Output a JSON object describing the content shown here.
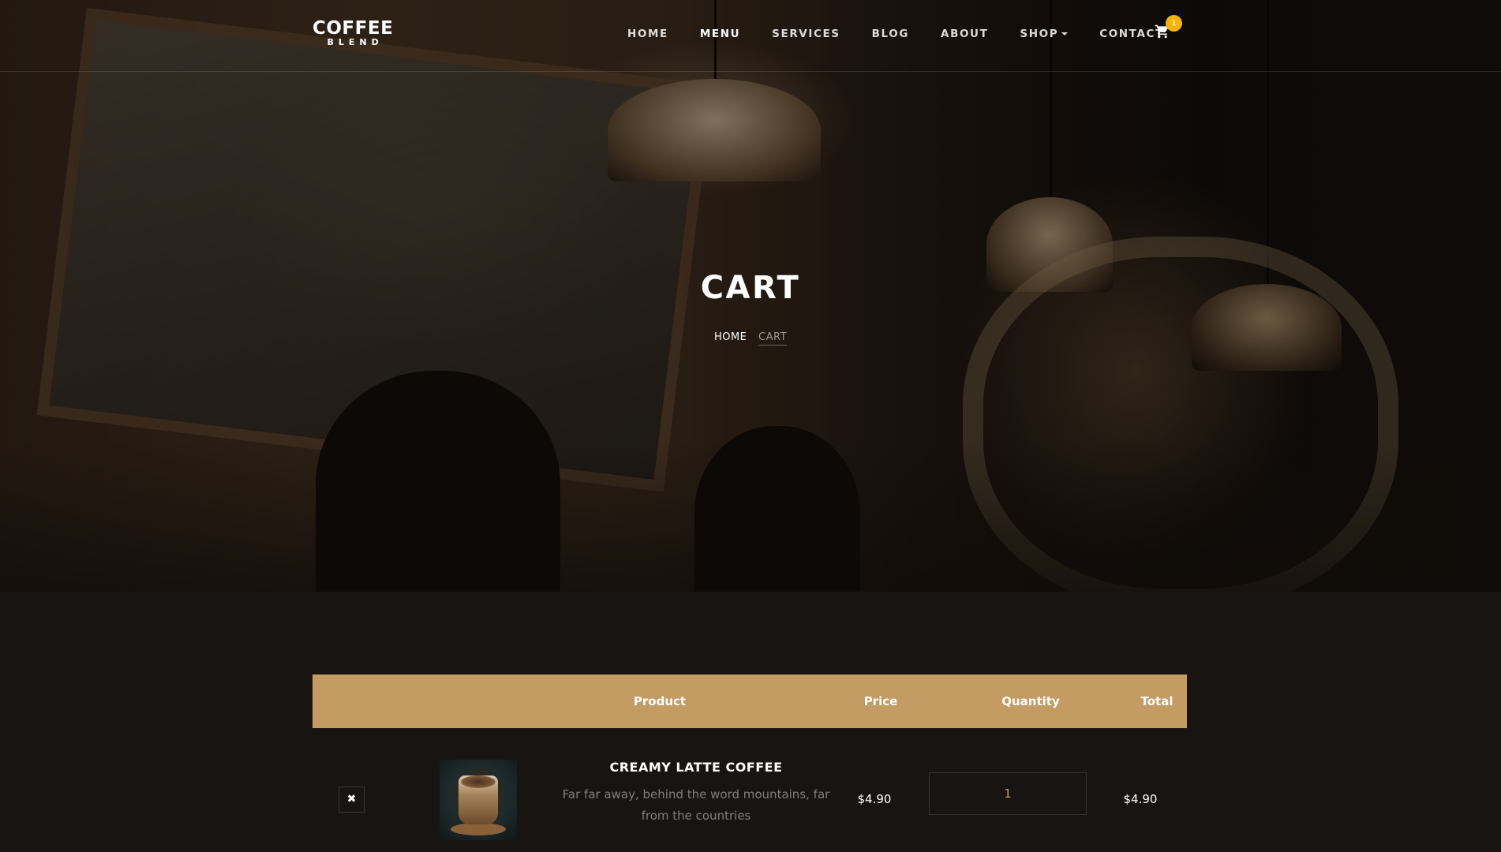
{
  "brand": {
    "line1": "COFFEE",
    "line2": "BLEND"
  },
  "nav": {
    "items": [
      {
        "label": "HOME"
      },
      {
        "label": "MENU"
      },
      {
        "label": "SERVICES"
      },
      {
        "label": "BLOG"
      },
      {
        "label": "ABOUT"
      },
      {
        "label": "SHOP"
      },
      {
        "label": "CONTACT"
      }
    ],
    "cart_count": "1"
  },
  "hero": {
    "title": "CART",
    "breadcrumb": {
      "home": "HOME",
      "current": "CART"
    }
  },
  "cart": {
    "headers": {
      "product": "Product",
      "price": "Price",
      "quantity": "Quantity",
      "total": "Total"
    },
    "items": [
      {
        "remove_label": "✖",
        "name": "CREAMY LATTE COFFEE",
        "description": "Far far away, behind the word mountains, far from the countries",
        "price": "$4.90",
        "quantity": "1",
        "total": "$4.90"
      }
    ]
  },
  "colors": {
    "accent": "#c49b63",
    "badge": "#f5b407",
    "background": "#171412"
  },
  "icons": {
    "cart": "cart-icon",
    "remove": "close-icon",
    "shop_dropdown": "caret-down-icon"
  }
}
